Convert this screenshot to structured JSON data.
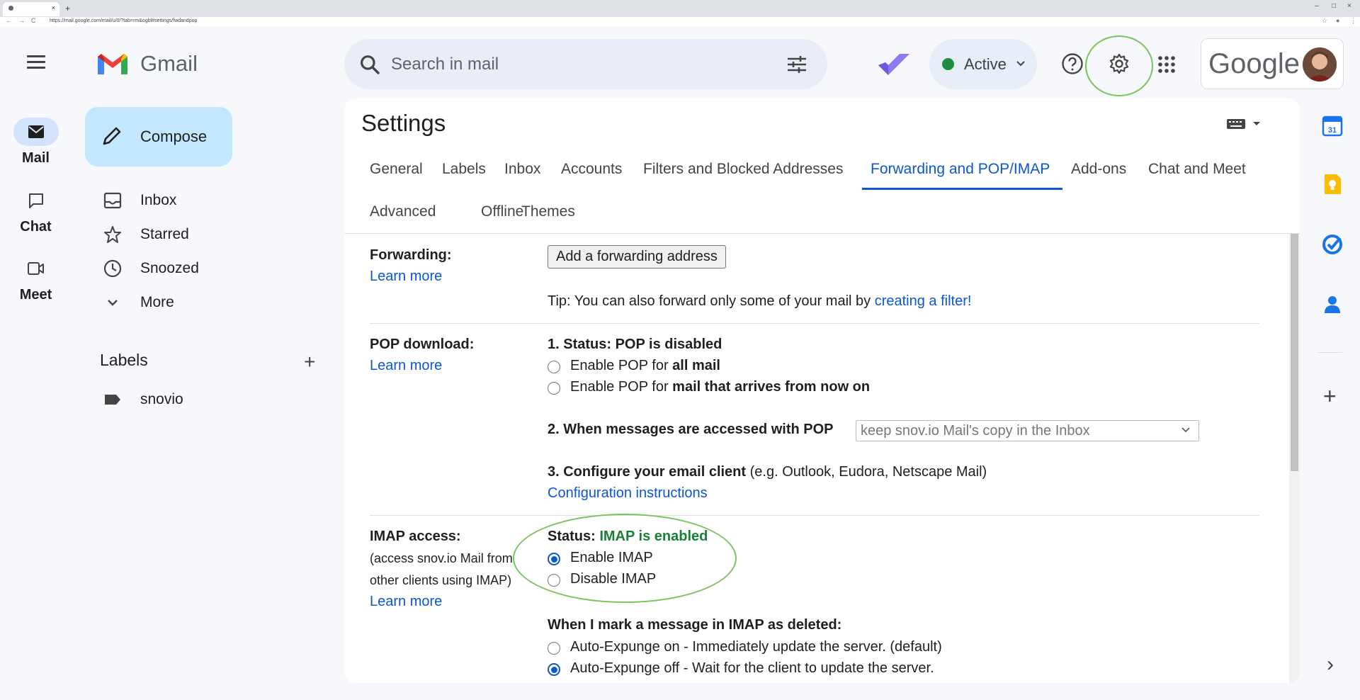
{
  "browser": {
    "tab_close": "×",
    "new_tab": "+",
    "url": "https://mail.google.com/mail/u/0/?tab=rm&ogbl#settings/fwdandpop",
    "back": "←",
    "forward": "→",
    "reload": "C",
    "minimize": "–",
    "maximize": "□",
    "close": "×"
  },
  "header": {
    "app_name": "Gmail",
    "search_placeholder": "Search in mail",
    "status_label": "Active",
    "account_brand": "Google",
    "colors": {
      "accent": "#0b57d0",
      "active_dot": "#1e8e3e",
      "highlight_ring": "#7ac35d"
    }
  },
  "rail": {
    "items": [
      {
        "label": "Mail",
        "icon": "mail-icon"
      },
      {
        "label": "Chat",
        "icon": "chat-icon"
      },
      {
        "label": "Meet",
        "icon": "meet-icon"
      }
    ]
  },
  "nav": {
    "compose_label": "Compose",
    "items": [
      {
        "label": "Inbox",
        "icon": "inbox-icon"
      },
      {
        "label": "Starred",
        "icon": "star-icon"
      },
      {
        "label": "Snoozed",
        "icon": "clock-icon"
      },
      {
        "label": "More",
        "icon": "chevron-down-icon"
      }
    ],
    "labels_heading": "Labels",
    "labels_add": "+",
    "labels": [
      {
        "label": "snovio",
        "icon": "label-icon"
      }
    ]
  },
  "settings": {
    "title": "Settings",
    "tabs": [
      {
        "label": "General"
      },
      {
        "label": "Labels"
      },
      {
        "label": "Inbox"
      },
      {
        "label": "Accounts"
      },
      {
        "label": "Filters and Blocked Addresses"
      },
      {
        "label": "Forwarding and POP/IMAP",
        "selected": true
      },
      {
        "label": "Add-ons"
      },
      {
        "label": "Chat and Meet"
      },
      {
        "label": "Advanced"
      },
      {
        "label": "Offline"
      },
      {
        "label": "Themes"
      }
    ],
    "forwarding": {
      "label": "Forwarding:",
      "learn_more": "Learn more",
      "button": "Add a forwarding address",
      "tip_text": "Tip: You can also forward only some of your mail by ",
      "tip_link": "creating a filter!"
    },
    "pop": {
      "label": "POP download:",
      "learn_more": "Learn more",
      "status": "1. Status: POP is disabled",
      "option1_prefix": "Enable POP for ",
      "option1_bold": "all mail",
      "option2_prefix": "Enable POP for ",
      "option2_bold": "mail that arrives from now on",
      "when_label": "2. When messages are accessed with POP",
      "when_value": "keep snov.io Mail's copy in the Inbox",
      "configure_label": "3. Configure your email client",
      "configure_note": " (e.g. Outlook, Eudora, Netscape Mail)",
      "config_link": "Configuration instructions"
    },
    "imap": {
      "label": "IMAP access:",
      "sub_line1": "(access snov.io Mail from",
      "sub_line2": "other clients using IMAP)",
      "learn_more": "Learn more",
      "status_prefix": "Status: ",
      "status_value": "IMAP is enabled",
      "enable": "Enable IMAP",
      "disable": "Disable IMAP",
      "selected": "Enable IMAP",
      "deleted_heading": "When I mark a message in IMAP as deleted:",
      "expunge_on": "Auto-Expunge on - Immediately update the server. (default)",
      "expunge_off": "Auto-Expunge off - Wait for the client to update the server.",
      "expunge_selected": "Auto-Expunge off"
    }
  },
  "right_rail": {
    "calendar_day": "31",
    "add": "+",
    "expand": "›"
  }
}
